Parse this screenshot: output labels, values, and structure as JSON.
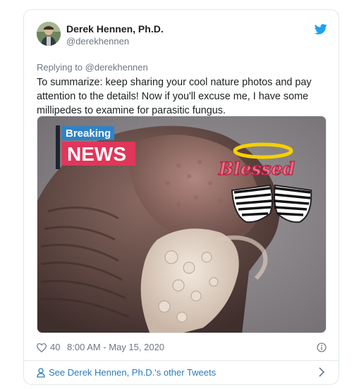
{
  "tweet": {
    "author_name": "Derek Hennen, Ph.D.",
    "author_handle": "@derekhennen",
    "replying_to": "Replying to @derekhennen",
    "text": "To summarize: keep sharing your cool nature photos and pay attention to the details! Now if you'll excuse me, I have some millipedes to examine for parasitic fungus.",
    "media": {
      "sticker_top": "Breaking",
      "sticker_bottom": "NEWS",
      "blessed": "Blessed"
    },
    "likes": "40",
    "timestamp": "8:00 AM - May 15, 2020",
    "other_tweets": "See Derek Hennen, Ph.D.'s other Tweets"
  },
  "icons": {
    "brand": "twitter-bird-icon",
    "like": "heart-icon",
    "info": "info-icon",
    "profile": "person-icon",
    "more": "chevron-right-icon"
  },
  "colors": {
    "brand": "#1da1f2",
    "link": "#2b7bb9",
    "muted": "#697882",
    "breaking_bg": "#2f82c9",
    "news_bg": "#e0365a",
    "blessed": "#e03a5c",
    "halo": "#f5d000"
  }
}
